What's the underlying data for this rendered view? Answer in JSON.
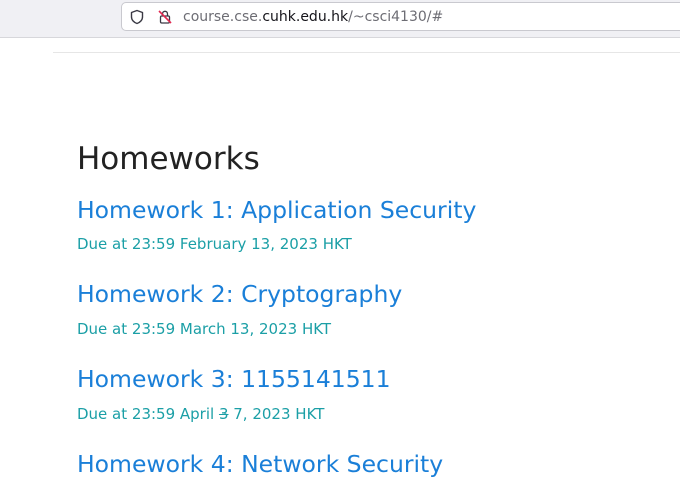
{
  "browser": {
    "url_prefix": "course.cse.",
    "url_domain": "cuhk.edu.hk",
    "url_path": "/~csci4130/#"
  },
  "page": {
    "heading": "Homeworks",
    "homeworks": [
      {
        "title": "Homework 1: Application Security",
        "due": "Due at 23:59 February 13, 2023 HKT"
      },
      {
        "title": "Homework 2: Cryptography",
        "due": "Due at 23:59 March 13, 2023 HKT"
      },
      {
        "title": "Homework 3: 1155141511",
        "due_before": "Due at 23:59 April ",
        "due_struck": "3",
        "due_after": " 7, 2023 HKT"
      },
      {
        "title": "Homework 4: Network Security"
      }
    ]
  },
  "colors": {
    "link": "#1a7fd8",
    "due": "#1b9fa6",
    "heading": "#222222"
  },
  "icons": [
    "shield-icon",
    "insecure-lock-icon"
  ]
}
